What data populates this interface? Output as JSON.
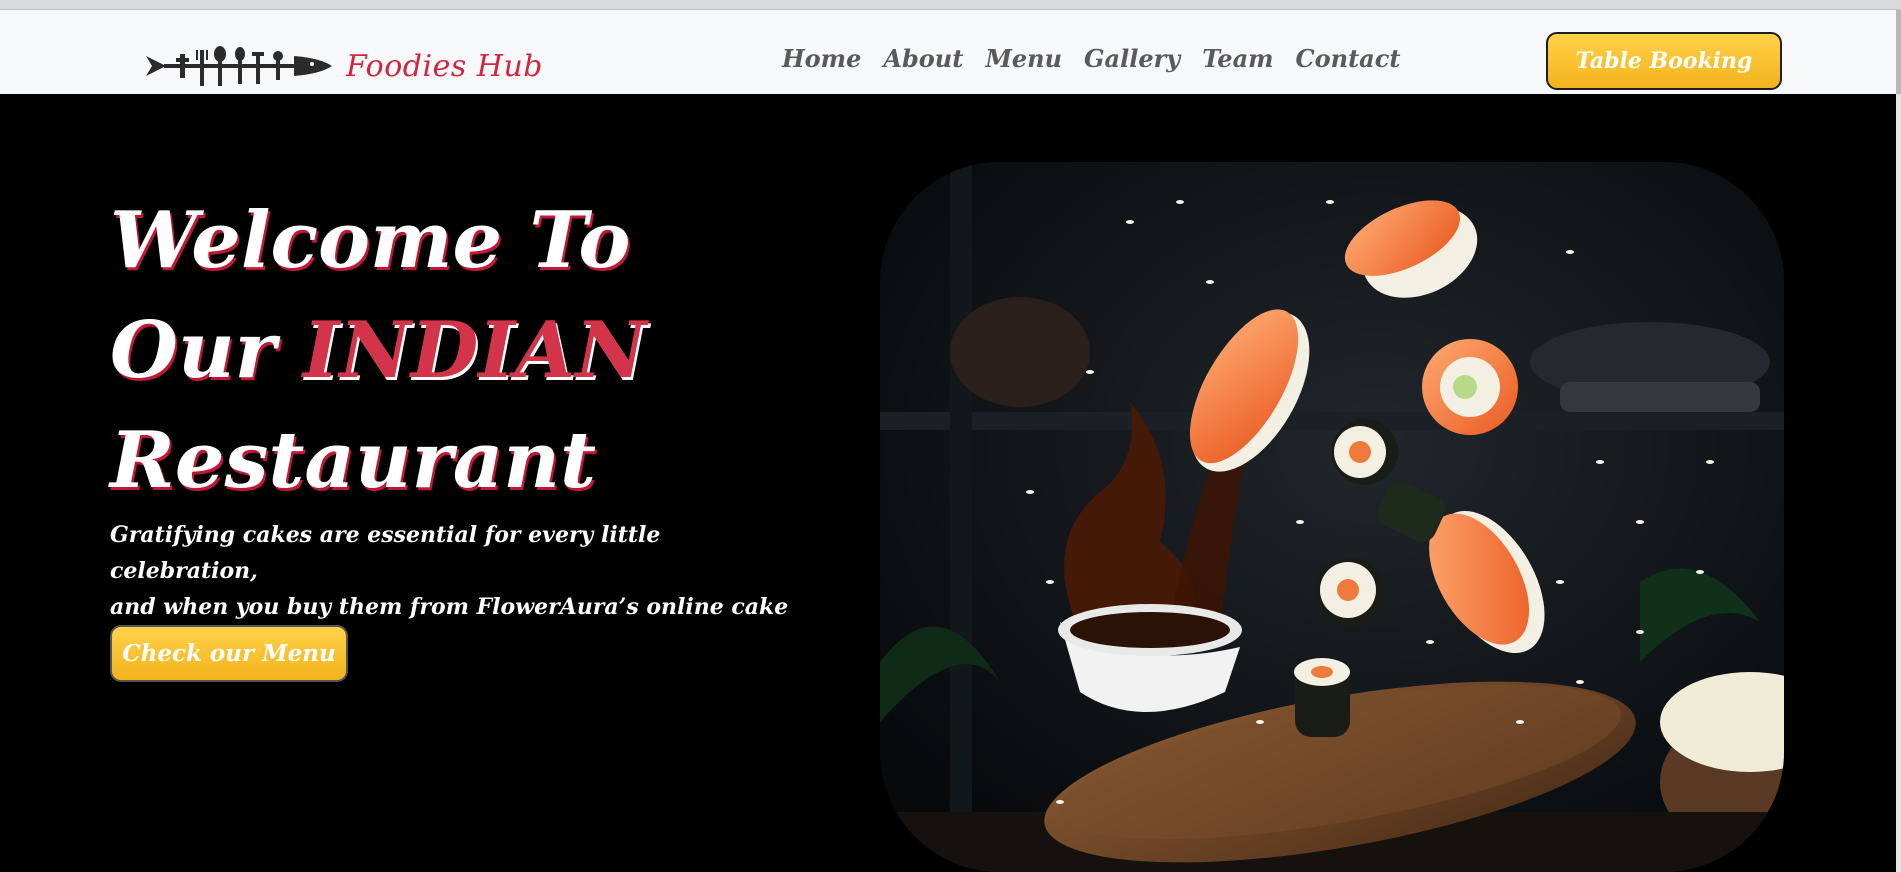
{
  "brand": {
    "name": "Foodies Hub",
    "color": "#d2263f",
    "logo_icon": "cutlery-fish-logo-icon"
  },
  "nav": {
    "items": [
      {
        "label": "Home"
      },
      {
        "label": "About"
      },
      {
        "label": "Menu"
      },
      {
        "label": "Gallery"
      },
      {
        "label": "Team"
      },
      {
        "label": "Contact"
      }
    ]
  },
  "header": {
    "cta_label": "Table Booking"
  },
  "hero": {
    "title_line1": "Welcome To",
    "title_line2_prefix": "Our",
    "title_line2_accent": "INDIAN",
    "title_line3": "Restaurant",
    "description_line1": "Gratifying cakes are essential for every little celebration,",
    "description_line2": "and when you buy them from FlowerAura’s online cake shop,",
    "cta_label": "Check our Menu",
    "image": "flying-sushi-soy-sauce-photo"
  },
  "colors": {
    "accent": "#d3344a",
    "button": "#f9c02a",
    "background": "#000000",
    "navbar": "#f7f8fa"
  }
}
